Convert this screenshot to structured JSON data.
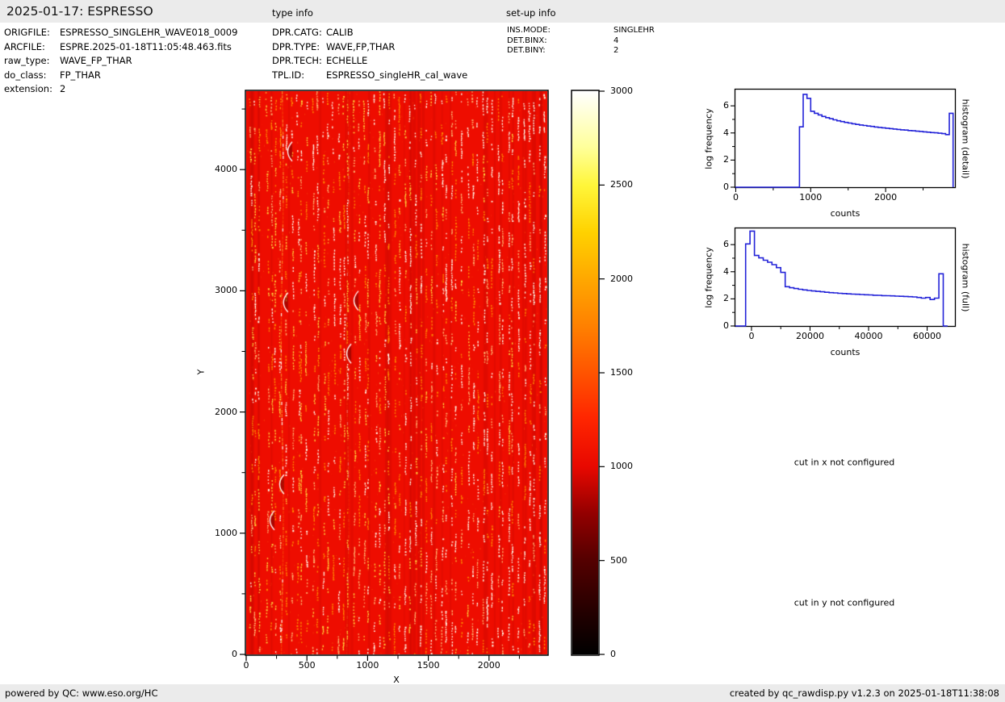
{
  "page": {
    "title": "2025-01-17: ESPRESSO",
    "section_titles": {
      "type_info": "type info",
      "setup_info": "set-up info"
    }
  },
  "file_info": [
    {
      "label": "ORIGFILE:",
      "value": "ESPRESSO_SINGLEHR_WAVE018_0009"
    },
    {
      "label": "ARCFILE:",
      "value": "ESPRE.2025-01-18T11:05:48.463.fits"
    },
    {
      "label": "raw_type:",
      "value": "WAVE_FP_THAR"
    },
    {
      "label": "do_class:",
      "value": "FP_THAR"
    },
    {
      "label": "extension:",
      "value": "2"
    }
  ],
  "type_info": [
    {
      "label": "DPR.CATG:",
      "value": "CALIB"
    },
    {
      "label": "DPR.TYPE:",
      "value": "WAVE,FP,THAR"
    },
    {
      "label": "DPR.TECH:",
      "value": "ECHELLE"
    },
    {
      "label": "TPL.ID:",
      "value": "ESPRESSO_singleHR_cal_wave"
    }
  ],
  "setup_info": [
    {
      "label": "INS.MODE:",
      "value": "SINGLEHR"
    },
    {
      "label": "DET.BINX:",
      "value": "4"
    },
    {
      "label": "DET.BINY:",
      "value": "2"
    }
  ],
  "notes": {
    "cut_x": "cut in x not configured",
    "cut_y": "cut in y not configured"
  },
  "footer": {
    "left": "powered by QC: www.eso.org/HC",
    "right": "created by qc_rawdisp.py v1.2.3 on 2025-01-18T11:38:08"
  },
  "colors": {
    "hist_line": "#2323d8",
    "bar_bg": "#ebebeb",
    "spine": "#000000"
  },
  "chart_data": [
    {
      "type": "heatmap",
      "name": "raw-frame-display",
      "title": "",
      "xlabel": "X",
      "ylabel": "Y",
      "xlim": [
        0,
        2480
      ],
      "ylim": [
        0,
        4647
      ],
      "x_ticks": [
        0,
        500,
        1000,
        1500,
        2000
      ],
      "x_minor_ticks": [
        250,
        750,
        1250,
        1750,
        2250
      ],
      "y_ticks": [
        0,
        1000,
        2000,
        3000,
        4000
      ],
      "y_minor_ticks": [
        500,
        1500,
        2500,
        3500,
        4500
      ],
      "colormap": "hot",
      "colorbar": {
        "vmin": 0,
        "vmax": 3000,
        "ticks": [
          0,
          500,
          1000,
          1500,
          2000,
          2500,
          3000
        ]
      },
      "description": "ESPRESSO raw WAVE_FP_THAR echelle frame: uniform ~1000-count red background crossed by curved vertical dotted echelle orders of bright yellow/white FP and ThAr emission lines; bright streak and small white arc artifacts near the left edge",
      "render": {
        "seed": 20250117,
        "base_color": "#ee0d00",
        "dark_band_color": "rgba(150,0,0,0.14)",
        "dot_colors": {
          "white": "#fff8e7",
          "yellow": "#ffd23c",
          "orange": "#ff8a00",
          "pale": "#ffb470"
        },
        "col_spacing": 6.4,
        "streaks": [
          {
            "x": 44,
            "alpha": 0.9
          },
          {
            "x": 125,
            "alpha": 0.35
          }
        ],
        "arcs": [
          [
            0.134,
            0.107
          ],
          [
            0.12,
            0.375
          ],
          [
            0.33,
            0.466
          ],
          [
            0.354,
            0.372
          ],
          [
            0.107,
            0.698
          ],
          [
            0.075,
            0.762
          ]
        ],
        "colorbar_stops": "linear-gradient(to top,#000000 0%,#1c0000 6%,#560000 17%,#930000 25%,#e80800 33.3%,#ff2600 42%,#ff5400 50%,#ff7f00 58%,#ffa800 66.7%,#ffd200 75%,#fff63a 83.3%,#ffff9a 90%,#ffffff 100%)"
      }
    },
    {
      "type": "line",
      "style": "step-histogram",
      "name": "histogram-detail",
      "xlabel": "counts",
      "ylabel": "log frequency",
      "right_label": "histogram (detail)",
      "xlim": [
        -5,
        2925
      ],
      "ylim": [
        0,
        7.2
      ],
      "x_ticks": [
        0,
        1000,
        2000
      ],
      "x_minor_ticks": [
        500,
        1500,
        2500
      ],
      "y_ticks": [
        0,
        2,
        4,
        6
      ],
      "y_minor_ticks": [
        1,
        3,
        5
      ],
      "bin_start": 0,
      "bin_width": 50,
      "log_frequency_values": [
        0,
        0,
        0,
        0,
        0,
        0,
        0,
        0,
        0,
        0,
        0,
        0,
        0,
        0,
        0,
        0,
        0,
        4.45,
        6.85,
        6.55,
        5.6,
        5.45,
        5.33,
        5.22,
        5.13,
        5.05,
        4.97,
        4.9,
        4.84,
        4.78,
        4.73,
        4.68,
        4.63,
        4.59,
        4.55,
        4.51,
        4.48,
        4.44,
        4.41,
        4.38,
        4.35,
        4.32,
        4.29,
        4.26,
        4.23,
        4.21,
        4.18,
        4.16,
        4.13,
        4.11,
        4.08,
        4.06,
        4.03,
        4.01,
        3.98,
        3.95,
        3.88,
        5.45
      ]
    },
    {
      "type": "line",
      "style": "step-histogram",
      "name": "histogram-full",
      "xlabel": "counts",
      "ylabel": "log frequency",
      "right_label": "histogram (full)",
      "xlim": [
        -5500,
        69500
      ],
      "ylim": [
        0,
        7.2
      ],
      "x_ticks": [
        0,
        20000,
        40000,
        60000
      ],
      "x_minor_ticks": [
        10000,
        30000,
        50000
      ],
      "y_ticks": [
        0,
        2,
        4,
        6
      ],
      "y_minor_ticks": [
        1,
        3,
        5
      ],
      "bin_start": -2000,
      "bin_width": 1500,
      "log_frequency_values": [
        6.05,
        7.0,
        5.2,
        5.02,
        4.85,
        4.7,
        4.52,
        4.3,
        3.95,
        2.9,
        2.82,
        2.76,
        2.71,
        2.66,
        2.62,
        2.58,
        2.55,
        2.52,
        2.49,
        2.46,
        2.44,
        2.41,
        2.39,
        2.37,
        2.35,
        2.34,
        2.32,
        2.3,
        2.29,
        2.27,
        2.26,
        2.24,
        2.23,
        2.22,
        2.2,
        2.19,
        2.18,
        2.16,
        2.14,
        2.1,
        2.05,
        2.1,
        1.95,
        2.05,
        3.85,
        0
      ]
    }
  ]
}
